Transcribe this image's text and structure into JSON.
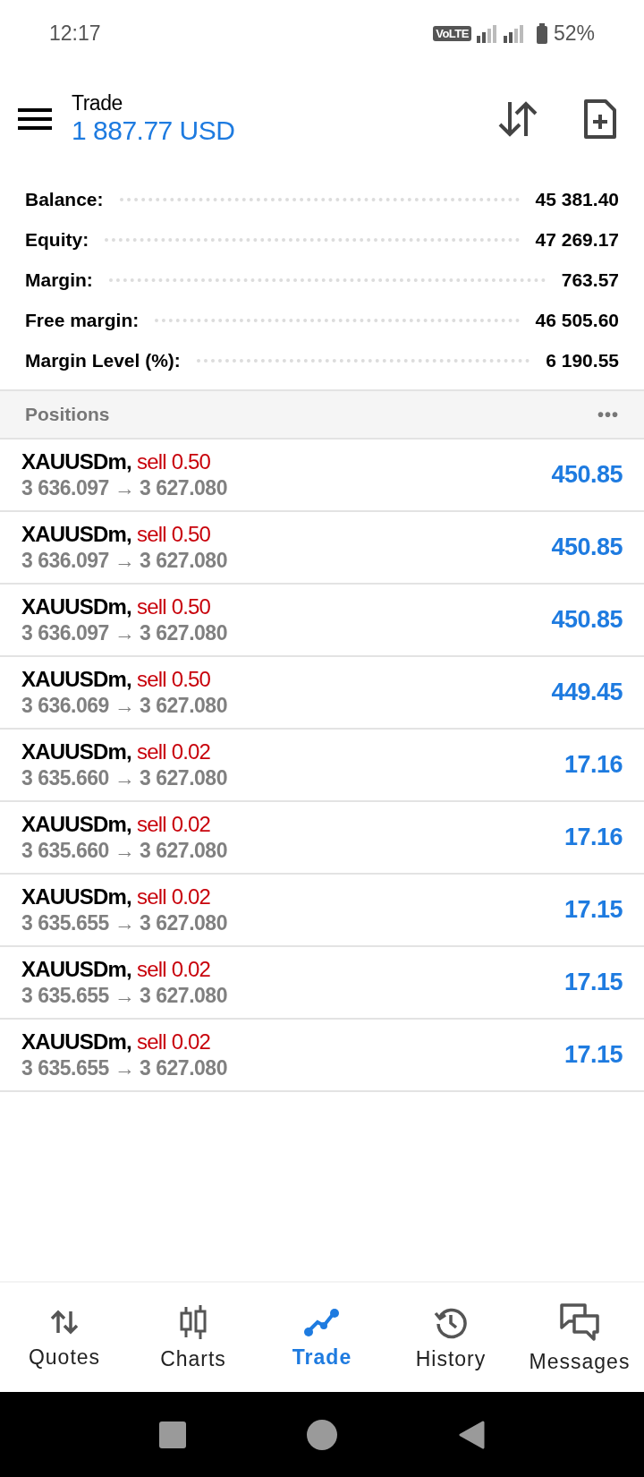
{
  "status_bar": {
    "time": "12:17",
    "network_badge": "VoLTE",
    "battery": "52%"
  },
  "header": {
    "title": "Trade",
    "amount": "1 887.77 USD"
  },
  "summary": [
    {
      "label": "Balance:",
      "value": "45 381.40"
    },
    {
      "label": "Equity:",
      "value": "47 269.17"
    },
    {
      "label": "Margin:",
      "value": "763.57"
    },
    {
      "label": "Free margin:",
      "value": "46 505.60"
    },
    {
      "label": "Margin Level (%):",
      "value": "6 190.55"
    }
  ],
  "positions_header": {
    "title": "Positions",
    "menu": "•••"
  },
  "positions": [
    {
      "symbol": "XAUUSDm,",
      "order": "sell 0.50",
      "prices": "3 636.097 → 3 627.080",
      "profit": "450.85"
    },
    {
      "symbol": "XAUUSDm,",
      "order": "sell 0.50",
      "prices": "3 636.097 → 3 627.080",
      "profit": "450.85"
    },
    {
      "symbol": "XAUUSDm,",
      "order": "sell 0.50",
      "prices": "3 636.097 → 3 627.080",
      "profit": "450.85"
    },
    {
      "symbol": "XAUUSDm,",
      "order": "sell 0.50",
      "prices": "3 636.069 → 3 627.080",
      "profit": "449.45"
    },
    {
      "symbol": "XAUUSDm,",
      "order": "sell 0.02",
      "prices": "3 635.660 → 3 627.080",
      "profit": "17.16"
    },
    {
      "symbol": "XAUUSDm,",
      "order": "sell 0.02",
      "prices": "3 635.660 → 3 627.080",
      "profit": "17.16"
    },
    {
      "symbol": "XAUUSDm,",
      "order": "sell 0.02",
      "prices": "3 635.655 → 3 627.080",
      "profit": "17.15"
    },
    {
      "symbol": "XAUUSDm,",
      "order": "sell 0.02",
      "prices": "3 635.655 → 3 627.080",
      "profit": "17.15"
    },
    {
      "symbol": "XAUUSDm,",
      "order": "sell 0.02",
      "prices": "3 635.655 → 3 627.080",
      "profit": "17.15"
    }
  ],
  "bottom_nav": [
    {
      "kind": "quotes",
      "label": "Quotes",
      "selected": false
    },
    {
      "kind": "charts",
      "label": "Charts",
      "selected": false
    },
    {
      "kind": "trade",
      "label": "Trade",
      "selected": true
    },
    {
      "kind": "history",
      "label": "History",
      "selected": false
    },
    {
      "kind": "messages",
      "label": "Messages",
      "selected": false
    }
  ]
}
